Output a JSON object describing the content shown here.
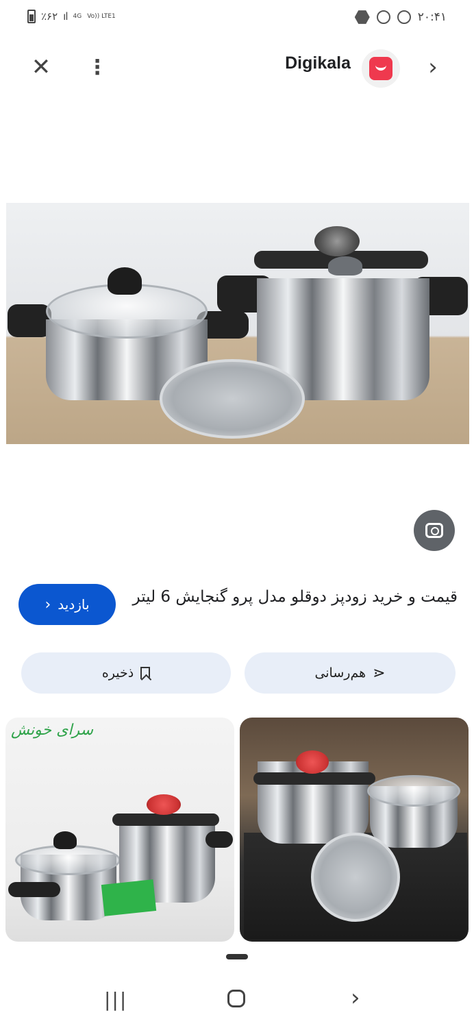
{
  "status_bar": {
    "battery": "٪۶۲",
    "signal": "ıl",
    "network_top": "4G",
    "network_bottom": "Vo)) LTE1",
    "time": "۲۰:۴۱"
  },
  "top_bar": {
    "site_name": "Digikala",
    "close_icon": "close-icon",
    "more_icon": "more-vert-icon",
    "next_icon": "chevron-right-icon"
  },
  "result": {
    "title": "قیمت و خرید زودپز دوقلو مدل پرو گنجایش 6 لیتر",
    "visit_label": "بازدید"
  },
  "actions": {
    "share_label": "هم‌رسانی",
    "save_label": "ذخیره"
  },
  "related": {
    "watermark": "سرای خونش"
  },
  "colors": {
    "brand": "#ef394e",
    "visit_button": "#0b57d0",
    "action_bg": "#e8eef8"
  }
}
